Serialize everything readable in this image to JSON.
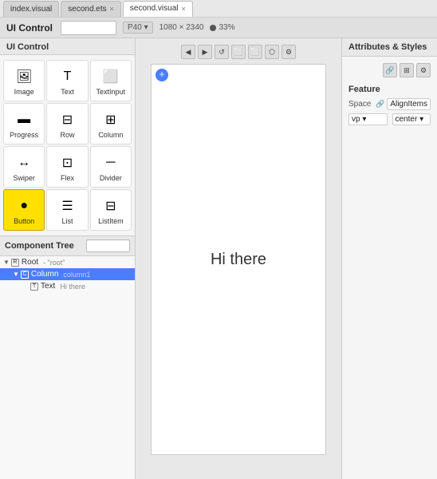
{
  "tabs": [
    {
      "label": "index.visual",
      "active": false,
      "closable": false
    },
    {
      "label": "second.ets",
      "active": false,
      "closable": true
    },
    {
      "label": "second.visual",
      "active": true,
      "closable": true
    }
  ],
  "titleBar": {
    "title": "UI Control",
    "searchPlaceholder": "",
    "device": "P40 ▾",
    "resolution": "1080 × 2340",
    "zoom": "33%"
  },
  "components": [
    {
      "label": "Image",
      "icon": "🖼"
    },
    {
      "label": "Text",
      "icon": "T"
    },
    {
      "label": "TextInput",
      "icon": "⬜"
    },
    {
      "label": "Progress",
      "icon": "▬"
    },
    {
      "label": "Row",
      "icon": "⊟"
    },
    {
      "label": "Column",
      "icon": "⊞"
    },
    {
      "label": "Swiper",
      "icon": "↔"
    },
    {
      "label": "Flex",
      "icon": "⊡"
    },
    {
      "label": "Divider",
      "icon": "─"
    },
    {
      "label": "Button",
      "icon": "●",
      "active": true
    },
    {
      "label": "List",
      "icon": "☰"
    },
    {
      "label": "ListItem",
      "icon": "⊟"
    }
  ],
  "componentTree": {
    "title": "Component Tree",
    "searchPlaceholder": "",
    "nodes": [
      {
        "level": 0,
        "type": "Root",
        "tag": "- \"root\"",
        "value": "",
        "icon": "R",
        "expanded": true,
        "selected": false
      },
      {
        "level": 1,
        "type": "Column",
        "tag": "column1",
        "value": "",
        "icon": "C",
        "expanded": true,
        "selected": true
      },
      {
        "level": 2,
        "type": "Text",
        "tag": "Hi there",
        "value": "",
        "icon": "T",
        "expanded": false,
        "selected": false
      }
    ]
  },
  "canvas": {
    "content": "Hi there",
    "toolbarButtons": [
      "◀",
      "▶",
      "↺",
      "⬜",
      "⬜",
      "⬡",
      "⬡"
    ]
  },
  "rightPanel": {
    "title": "Attributes & Styles",
    "featureTitle": "Feature",
    "toolButtons": [
      "🔗",
      "⊞",
      "⚙"
    ],
    "attributes": {
      "spaceLabel": "Space",
      "spaceValue": "AlignItems",
      "vpLabel": "vp ▾",
      "centerLabel": "center ▾"
    }
  }
}
